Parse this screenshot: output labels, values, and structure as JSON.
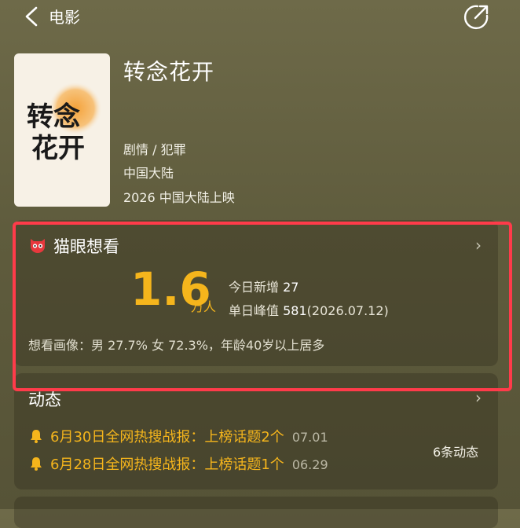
{
  "header": {
    "back_label": "电影"
  },
  "movie": {
    "title": "转念花开",
    "genre": "剧情 / 犯罪",
    "region": "中国大陆",
    "release": "2026 中国大陆上映",
    "poster_calligraphy": [
      "转念",
      "花开"
    ]
  },
  "want": {
    "title": "猫眼想看",
    "count": "1.6",
    "unit": "万人",
    "today_label": "今日新增",
    "today_value": "27",
    "peak_label": "单日峰值",
    "peak_value": "581",
    "peak_date": "(2026.07.12)",
    "portrait": "想看画像：男 27.7%  女 72.3%，年龄40岁以上居多"
  },
  "news": {
    "title": "动态",
    "items": [
      {
        "text": "6月30日全网热搜战报：上榜话题2个",
        "date": "07.01"
      },
      {
        "text": "6月28日全网热搜战报：上榜话题1个",
        "date": "06.29"
      }
    ],
    "count_label": "6条动态"
  },
  "colors": {
    "accent": "#f5b51c",
    "highlight": "#ff3b4a",
    "cat_brand": "#e8383d"
  }
}
